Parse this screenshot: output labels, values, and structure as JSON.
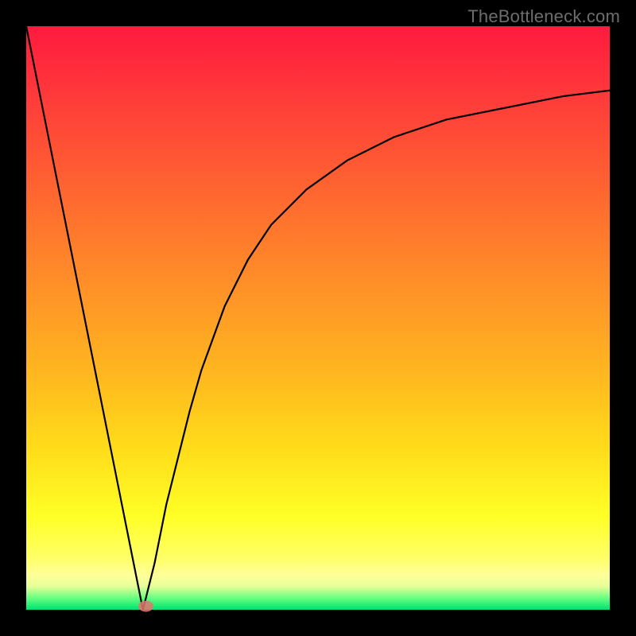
{
  "watermark": {
    "text": "TheBottleneck.com"
  },
  "chart_data": {
    "type": "line",
    "title": "",
    "xlabel": "",
    "ylabel": "",
    "xlim": [
      0,
      100
    ],
    "ylim": [
      0,
      100
    ],
    "grid": false,
    "background_gradient": {
      "direction": "vertical",
      "stops": [
        {
          "pos": 0.0,
          "color": "#ff1a3f"
        },
        {
          "pos": 0.5,
          "color": "#ff9926"
        },
        {
          "pos": 0.84,
          "color": "#ffff26"
        },
        {
          "pos": 1.0,
          "color": "#00e070"
        }
      ]
    },
    "series": [
      {
        "name": "left-branch",
        "x": [
          0,
          4,
          8,
          12,
          16,
          20
        ],
        "y": [
          100,
          80,
          60,
          40,
          20,
          0
        ]
      },
      {
        "name": "right-branch",
        "x": [
          20,
          22,
          24,
          26,
          28,
          30,
          34,
          38,
          42,
          48,
          55,
          63,
          72,
          82,
          92,
          100
        ],
        "y": [
          0,
          8,
          18,
          26,
          34,
          41,
          52,
          60,
          66,
          72,
          77,
          81,
          84,
          86,
          88,
          89
        ]
      }
    ],
    "marker": {
      "x": 20.5,
      "y": 0.6,
      "rx": 1.3,
      "ry": 0.95,
      "color": "#e4766f"
    }
  }
}
